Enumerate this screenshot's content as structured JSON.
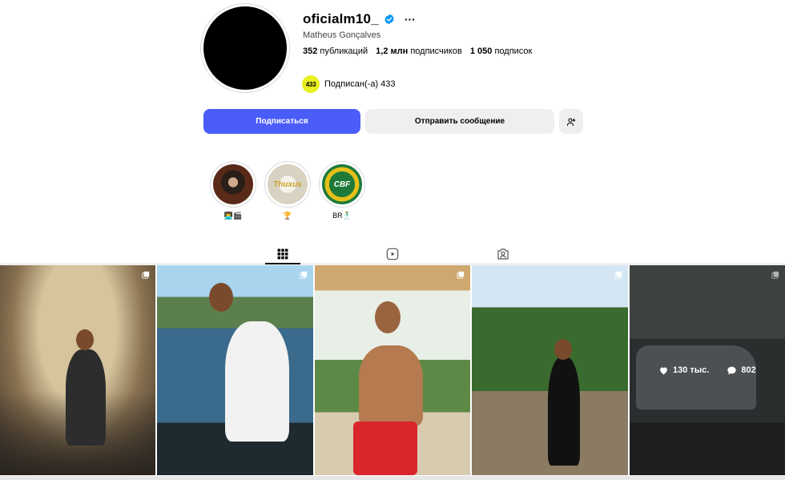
{
  "profile": {
    "username": "oficialm10_",
    "full_name": "Matheus Gonçalves",
    "more_icon": "ellipsis-icon",
    "verified_icon": "verified-badge-icon",
    "stats": {
      "posts_count": "352",
      "posts_label": "публикаций",
      "followers_count": "1,2 млн",
      "followers_label": "подписчиков",
      "following_count": "1 050",
      "following_label": "подписок"
    },
    "followed_by": {
      "logo_text": "433",
      "text": "Подписан(-а) 433"
    }
  },
  "actions": {
    "follow_label": "Подписаться",
    "message_label": "Отправить сообщение",
    "add_user_icon": "add-user-icon"
  },
  "highlights": [
    {
      "label": "👨‍💻🎬",
      "cover_text": ""
    },
    {
      "label": "🏆",
      "cover_text": "Thuxus"
    },
    {
      "label": "BR🕺",
      "cover_text": "CBF"
    }
  ],
  "tabs": [
    {
      "name": "posts",
      "icon": "grid-icon",
      "active": true
    },
    {
      "name": "reels",
      "icon": "reels-icon",
      "active": false
    },
    {
      "name": "tagged",
      "icon": "tagged-icon",
      "active": false
    }
  ],
  "posts": [
    {
      "multi": true
    },
    {
      "multi": true
    },
    {
      "multi": true
    },
    {
      "multi": true
    },
    {
      "multi": true,
      "likes": "130 тыс.",
      "comments": "802"
    }
  ],
  "colors": {
    "follow_button": "#4a5df9",
    "secondary_button": "#efefef",
    "verified": "#0095f6",
    "logo_433": "#e8f020"
  }
}
